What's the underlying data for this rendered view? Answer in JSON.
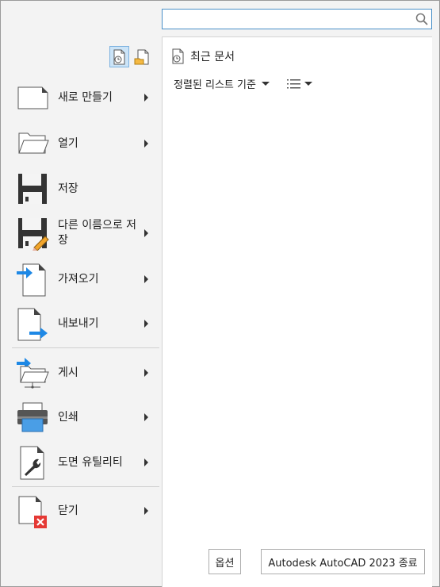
{
  "search": {
    "value": "",
    "placeholder": ""
  },
  "recent": {
    "title": "최근 문서",
    "sort_label": "정렬된 리스트 기준"
  },
  "menu": [
    {
      "label": "새로 만들기",
      "icon": "new-document-icon",
      "has_submenu": true
    },
    {
      "label": "열기",
      "icon": "open-folder-icon",
      "has_submenu": true
    },
    {
      "label": "저장",
      "icon": "save-disk-icon",
      "has_submenu": false
    },
    {
      "label": "다른 이름으로 저장",
      "icon": "save-as-icon",
      "has_submenu": true
    },
    {
      "label": "가져오기",
      "icon": "import-icon",
      "has_submenu": true
    },
    {
      "label": "내보내기",
      "icon": "export-icon",
      "has_submenu": true
    },
    {
      "label": "게시",
      "icon": "publish-icon",
      "has_submenu": true
    },
    {
      "label": "인쇄",
      "icon": "printer-icon",
      "has_submenu": true
    },
    {
      "label": "도면 유틸리티",
      "icon": "drawing-utilities-icon",
      "has_submenu": true
    },
    {
      "label": "닫기",
      "icon": "close-document-icon",
      "has_submenu": true
    }
  ],
  "buttons": {
    "options": "옵션",
    "exit": "Autodesk AutoCAD 2023 종료"
  },
  "colors": {
    "accent": "#1e88e5",
    "selection": "#cce4f7",
    "close_red": "#e53935"
  }
}
